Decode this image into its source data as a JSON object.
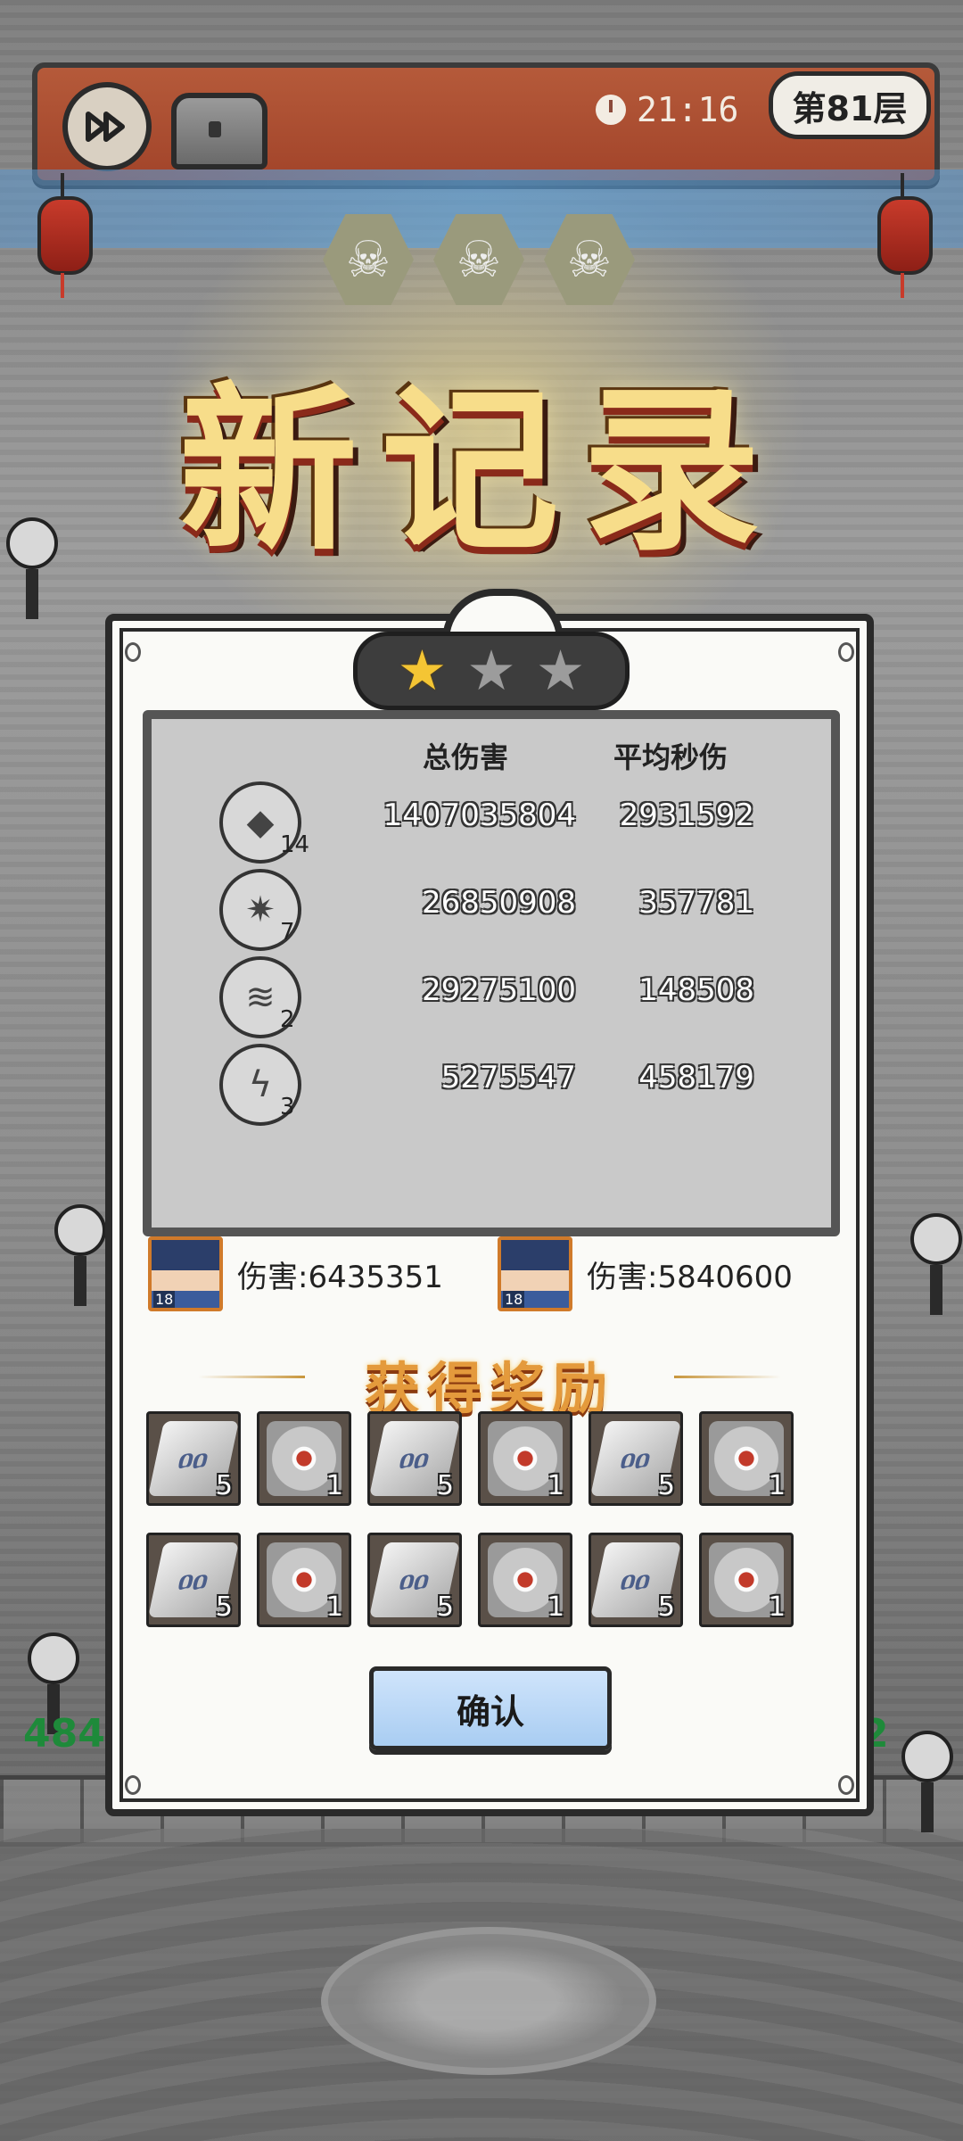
{
  "timer": "21:16",
  "floor_label": "第81层",
  "title": "新记录",
  "stars": {
    "earned": 1,
    "total": 3
  },
  "stats": {
    "headers": {
      "total_damage": "总伤害",
      "avg_dps": "平均秒伤"
    },
    "rows": [
      {
        "icon": "crystal-shard-icon",
        "count": "14",
        "total": "1407035804",
        "dps": "2931592"
      },
      {
        "icon": "crystal-cluster-icon",
        "count": "7",
        "total": "26850908",
        "dps": "357781"
      },
      {
        "icon": "spiral-drill-icon",
        "count": "2",
        "total": "29275100",
        "dps": "148508"
      },
      {
        "icon": "lightning-crack-icon",
        "count": "3",
        "total": "5275547",
        "dps": "458179"
      }
    ]
  },
  "heroes": [
    {
      "level": "18",
      "damage": "伤害:6435351"
    },
    {
      "level": "18",
      "damage": "伤害:5840600"
    }
  ],
  "rewards": {
    "title": "获得奖励",
    "items": [
      {
        "icon": "silver-ingot-icon",
        "qty": "5"
      },
      {
        "icon": "red-core-ore-icon",
        "qty": "1"
      },
      {
        "icon": "silver-ingot-icon",
        "qty": "5"
      },
      {
        "icon": "red-core-ore-icon",
        "qty": "1"
      },
      {
        "icon": "silver-ingot-icon",
        "qty": "5"
      },
      {
        "icon": "red-core-ore-icon",
        "qty": "1"
      },
      {
        "icon": "silver-ingot-icon",
        "qty": "5"
      },
      {
        "icon": "red-core-ore-icon",
        "qty": "1"
      },
      {
        "icon": "silver-ingot-icon",
        "qty": "5"
      },
      {
        "icon": "red-core-ore-icon",
        "qty": "1"
      },
      {
        "icon": "silver-ingot-icon",
        "qty": "5"
      },
      {
        "icon": "red-core-ore-icon",
        "qty": "1"
      }
    ]
  },
  "confirm_label": "确认",
  "side_numbers": {
    "left": "484",
    "right": "2"
  },
  "colors": {
    "accent_gold": "#f7dd8a",
    "star_on": "#f4c534",
    "confirm_blue": "#a9cdf2",
    "topbar_red": "#a2442a"
  }
}
